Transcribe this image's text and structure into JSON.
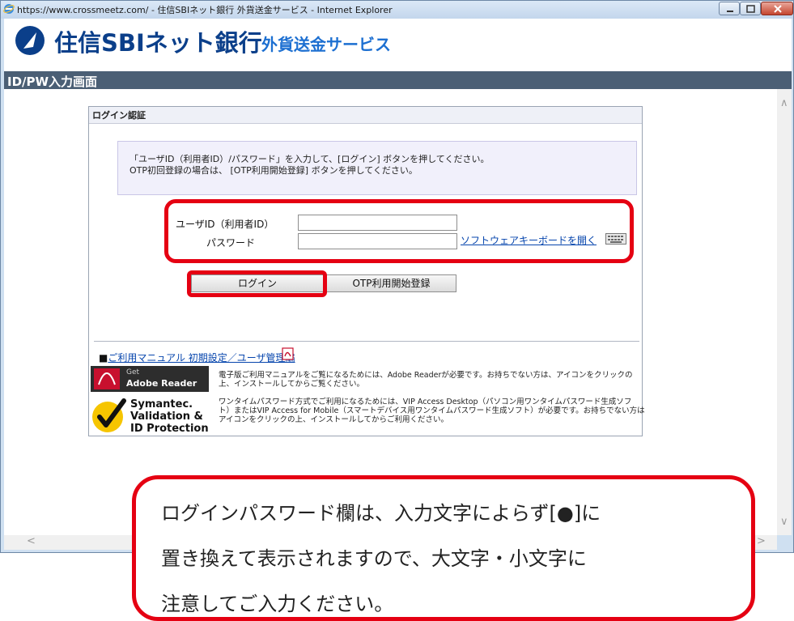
{
  "window": {
    "title": "https://www.crossmeetz.com/ - 住信SBIネット銀行 外貨送金サービス - Internet Explorer"
  },
  "banner": {
    "bank_name": "住信SBIネット銀行",
    "service_name": "外貨送金サービス"
  },
  "screen": {
    "title": "ID/PW入力画面"
  },
  "login_panel": {
    "title": "ログイン認証",
    "info_line1": "「ユーザID（利用者ID）/パスワード」を入力して、[ログイン] ボタンを押してください。",
    "info_line2": "OTP初回登録の場合は、 [OTP利用開始登録] ボタンを押してください。",
    "user_id_label": "ユーザID（利用者ID）",
    "password_label": "パスワード",
    "user_id_value": "",
    "password_value": "",
    "software_keyboard_link": "ソフトウェアキーボードを開く",
    "login_button": "ログイン",
    "otp_button": "OTP利用開始登録"
  },
  "manual": {
    "link_prefix": "■",
    "link_text": "ご利用マニュアル 初期設定／ユーザ管理編",
    "adobe_get": "Get",
    "adobe_reader": "Adobe Reader",
    "adobe_note_line1": "電子版ご利用マニュアルをご覧になるためには、Adobe Readerが必要です。お持ちでない方は、アイコンをクリックの",
    "adobe_note_line2": "上、インストールしてからご覧ください。",
    "symantec_line1": "Symantec.",
    "symantec_line2": "Validation &",
    "symantec_line3": "ID Protection",
    "vip_note_line1": "ワンタイムパスワード方式でご利用になるためには、VIP Access Desktop（パソコン用ワンタイムパスワード生成ソフ",
    "vip_note_line2": "ト）またはVIP Access for Mobile（スマートデバイス用ワンタイムパスワード生成ソフト）が必要です。お持ちでない方は",
    "vip_note_line3": "アイコンをクリックの上、インストールしてからご利用ください。"
  },
  "callout": {
    "line1": "ログインパスワード欄は、入力文字によらず[●]に",
    "line2": "置き換えて表示されますので、大文字・小文字に",
    "line3": "注意してご入力ください。"
  },
  "colors": {
    "highlight_red": "#e50012",
    "brand_navy": "#0b3f8a",
    "brand_blue": "#1c6fd1",
    "header_bar": "#4b5f75",
    "link": "#0645ad"
  }
}
